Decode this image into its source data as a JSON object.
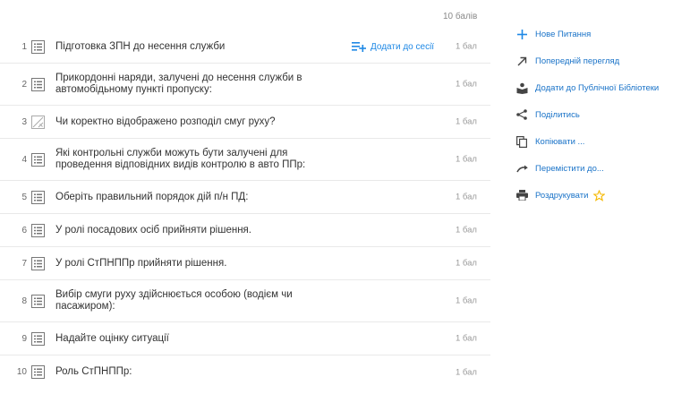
{
  "total_points": "10 балів",
  "add_to_session_label": "Додати до сесії",
  "questions": [
    {
      "num": "1",
      "text": "Підготовка ЗПН до несення служби",
      "points": "1 бал",
      "icon": "list-icon"
    },
    {
      "num": "2",
      "text": "Прикордонні наряди, залучені до несення служби в автомобідьному пункті пропуску:",
      "points": "1 бал",
      "icon": "list-icon"
    },
    {
      "num": "3",
      "text": "Чи коректно відображено розподіл смуг руху?",
      "points": "1 бал",
      "icon": "image-icon"
    },
    {
      "num": "4",
      "text": "Які контрольні служби можуть бути залучені для проведення відповідних видів контролю в авто ППр:",
      "points": "1 бал",
      "icon": "list-icon"
    },
    {
      "num": "5",
      "text": "Оберіть правильний порядок дій п/н ПД:",
      "points": "1 бал",
      "icon": "list-icon"
    },
    {
      "num": "6",
      "text": "У ролі посадових осіб прийняти рішення.",
      "points": "1 бал",
      "icon": "list-icon"
    },
    {
      "num": "7",
      "text": "У ролі СтПНППр прийняти рішення.",
      "points": "1 бал",
      "icon": "list-icon"
    },
    {
      "num": "8",
      "text": "Вибір смуги руху здійснюється особою (водієм чи пасажиром):",
      "points": "1 бал",
      "icon": "list-icon"
    },
    {
      "num": "9",
      "text": "Надайте оцінку ситуації",
      "points": "1 бал",
      "icon": "list-icon"
    },
    {
      "num": "10",
      "text": "Роль СтПНППр:",
      "points": "1 бал",
      "icon": "list-icon"
    }
  ],
  "sidebar": {
    "new_question": "Нове Питання",
    "preview": "Попередній перегляд",
    "add_to_library": "Додати до Публічної Бібліотеки",
    "share": "Поділитись",
    "copy": "Копіювати ...",
    "move": "Перемістити до...",
    "print": "Роздрукувати"
  },
  "colors": {
    "accent": "#1e88e5",
    "text": "#333333",
    "muted": "#999999",
    "star": "#f5b800"
  }
}
